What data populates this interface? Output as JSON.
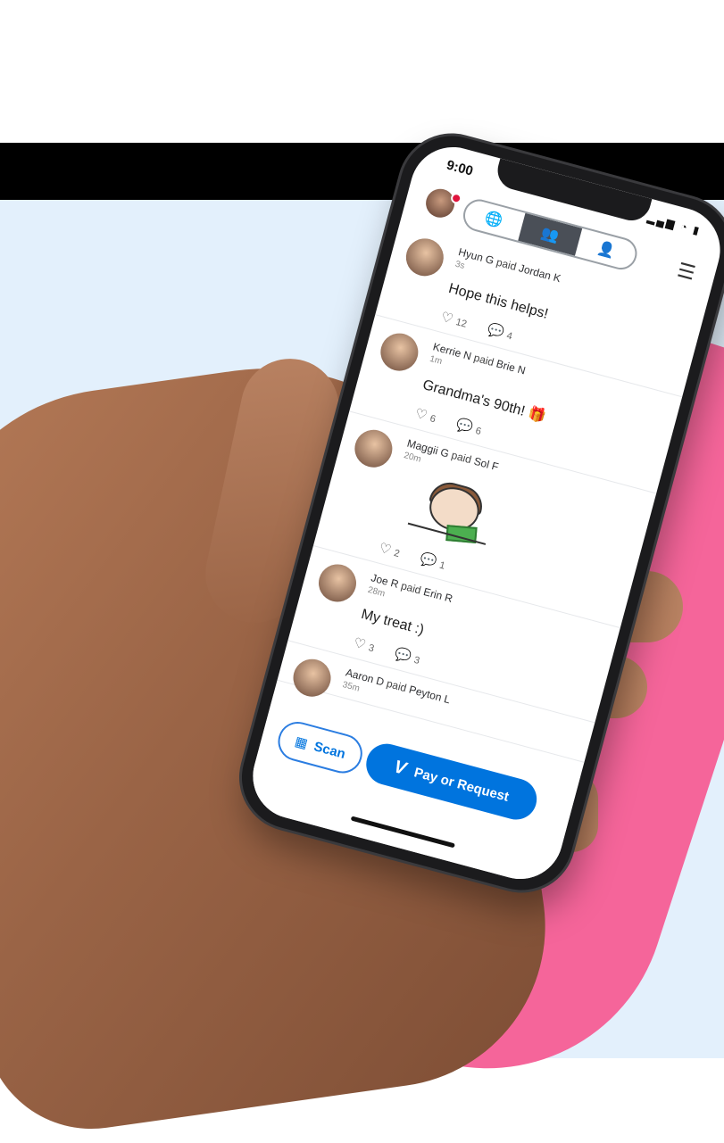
{
  "status": {
    "time": "9:00",
    "icons": "▂▄▆ ◔ ▮"
  },
  "tabs": [
    {
      "icon": "globe-icon",
      "glyph": "🌐"
    },
    {
      "icon": "friends-icon",
      "glyph": "👥"
    },
    {
      "icon": "person-icon",
      "glyph": "👤"
    }
  ],
  "menu": {
    "glyph": "☰"
  },
  "feed": [
    {
      "actor": "Hyun G",
      "verb": "paid",
      "target": "Jordan K",
      "time": "3s",
      "note": "Hope this helps!",
      "likes": "12",
      "comments": "4"
    },
    {
      "actor": "Kerrie N",
      "verb": "paid",
      "target": "Brie N",
      "time": "1m",
      "note": "Grandma's 90th! 🎁",
      "likes": "6",
      "comments": "6"
    },
    {
      "actor": "Maggii G",
      "verb": "paid",
      "target": "Sol F",
      "time": "20m",
      "note": "",
      "likes": "2",
      "comments": "1"
    },
    {
      "actor": "Joe R",
      "verb": "paid",
      "target": "Erin R",
      "time": "28m",
      "note": "My treat :)",
      "likes": "3",
      "comments": "3"
    },
    {
      "actor": "Aaron D",
      "verb": "paid",
      "target": "Peyton L",
      "time": "35m"
    }
  ],
  "actions": {
    "scan": "Scan",
    "pay": "Pay or Request",
    "pay_logo": "V"
  },
  "colors": {
    "brand_blue": "#0074de",
    "pink": "#f5659a",
    "background": "#e3f0fc"
  }
}
